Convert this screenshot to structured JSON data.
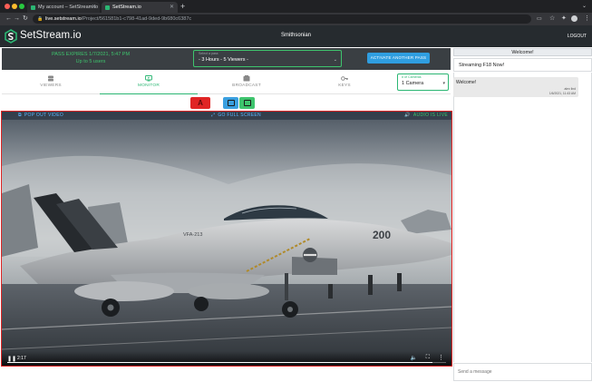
{
  "browser": {
    "tabs": [
      {
        "title": "My account – SetStream.io",
        "active": false
      },
      {
        "title": "SetStream.io",
        "active": true
      }
    ],
    "new_tab_icon": "plus-icon",
    "url_host": "live.setstream.io",
    "url_path": "/Project/561581b1-c798-41ad-9ded-9b680c6387c"
  },
  "header": {
    "logo_text": "SetStream.io",
    "org_name": "Smithsonian",
    "logout_label": "LOGOUT",
    "accent": "#2bb673"
  },
  "pass": {
    "expires_text": "PASS EXPIRES 1/7/2021, 5:47 PM",
    "users_text": "Up to 5 users",
    "select_label": "Select a pass",
    "select_value": "- 3 Hours - 5 Viewers -",
    "activate_label": "ACTIVATE ANOTHER PASS"
  },
  "nav": {
    "tabs": [
      {
        "label": "VIEWERS",
        "icon": "viewers-icon",
        "active": false
      },
      {
        "label": "MONITOR",
        "icon": "monitor-icon",
        "active": true
      },
      {
        "label": "BROADCAST",
        "icon": "broadcast-icon",
        "active": false
      },
      {
        "label": "KEYS",
        "icon": "key-icon",
        "active": false
      }
    ],
    "camera_select_label": "# of Cameras",
    "camera_select_value": "1 Camera"
  },
  "camera_buttons": {
    "a_label": "A",
    "a_color": "#e02424",
    "b_color": "#3aa0e0",
    "c_color": "#3ec46d"
  },
  "video": {
    "popout_label": "POP OUT VIDEO",
    "fullscreen_label": "GO FULL SCREEN",
    "audio_label": "AUDIO IS LIVE",
    "current_time": "2:17",
    "aircraft_label": "VFA-213",
    "aircraft_number": "200"
  },
  "chat": {
    "header": "Welcome!",
    "room_title": "Streaming F18 Now!",
    "messages": [
      {
        "text": "Welcome!",
        "author": "alex lind",
        "timestamp": "1/6/2021, 11:43 AM"
      }
    ],
    "input_placeholder": "Send a message"
  }
}
